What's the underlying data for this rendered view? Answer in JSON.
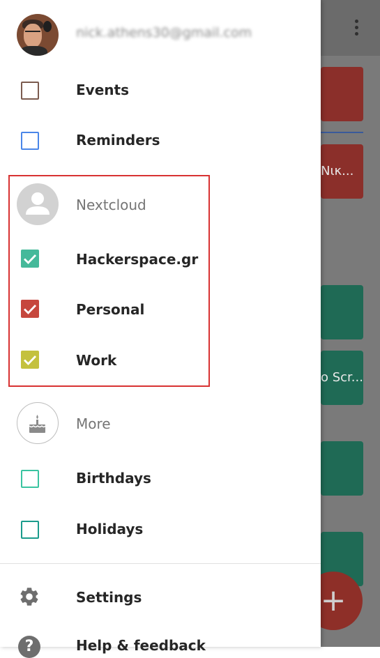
{
  "account": {
    "email": "nick.athens30@gmail.com"
  },
  "calendars": [
    {
      "label": "Events",
      "checked": false,
      "color": "#7b5b4f"
    },
    {
      "label": "Reminders",
      "checked": false,
      "color": "#4a86e8"
    }
  ],
  "nextcloud": {
    "label": "Nextcloud",
    "calendars": [
      {
        "label": "Hackerspace.gr",
        "checked": true,
        "color": "#45b99a"
      },
      {
        "label": "Personal",
        "checked": true,
        "color": "#c6473d"
      },
      {
        "label": "Work",
        "checked": true,
        "color": "#c4c13e"
      }
    ]
  },
  "more": {
    "label": "More",
    "calendars": [
      {
        "label": "Birthdays",
        "checked": false,
        "color": "#3ac4a0"
      },
      {
        "label": "Holidays",
        "checked": false,
        "color": "#1a9b8c"
      }
    ]
  },
  "footer": {
    "settings": "Settings",
    "help": "Help & feedback"
  },
  "background": {
    "event_partial_1": "Νικ...",
    "event_partial_2": "o Scr...",
    "fab_label": "+"
  },
  "colors": {
    "highlight_box": "#d83232",
    "event_red": "#8b2f2a",
    "event_green": "#1f6a55"
  }
}
